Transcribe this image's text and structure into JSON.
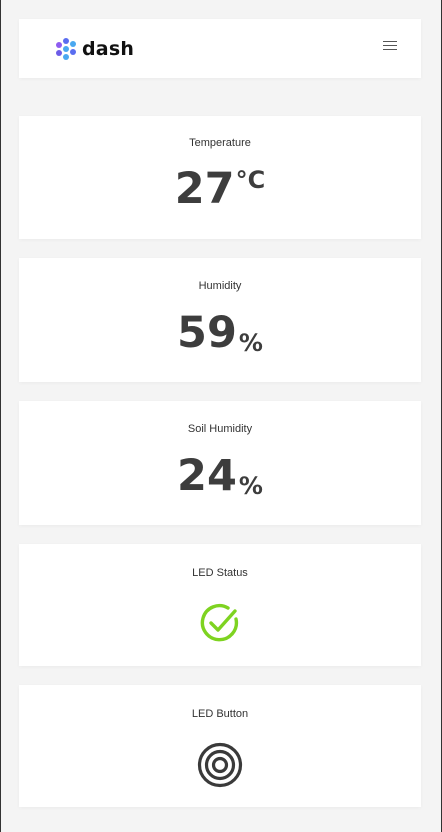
{
  "header": {
    "brand": "dash",
    "logo_icon": "dots-cluster-logo",
    "menu_icon": "hamburger-menu-icon"
  },
  "cards": {
    "temperature": {
      "title": "Temperature",
      "value": "27",
      "unit": "°C"
    },
    "humidity": {
      "title": "Humidity",
      "value": "59",
      "unit": "%"
    },
    "soil": {
      "title": "Soil Humidity",
      "value": "24",
      "unit": "%"
    },
    "led_status": {
      "title": "LED Status",
      "icon": "check-circle-icon",
      "color": "#7ed321"
    },
    "led_button": {
      "title": "LED Button",
      "icon": "target-icon",
      "color": "#3a3a3a"
    }
  },
  "colors": {
    "background": "#f4f4f4",
    "card": "#ffffff",
    "value_text": "#3d3d3d",
    "accent_green": "#7ed321",
    "logo_purple": "#6c5ce7",
    "logo_blue": "#4aa8f0"
  }
}
